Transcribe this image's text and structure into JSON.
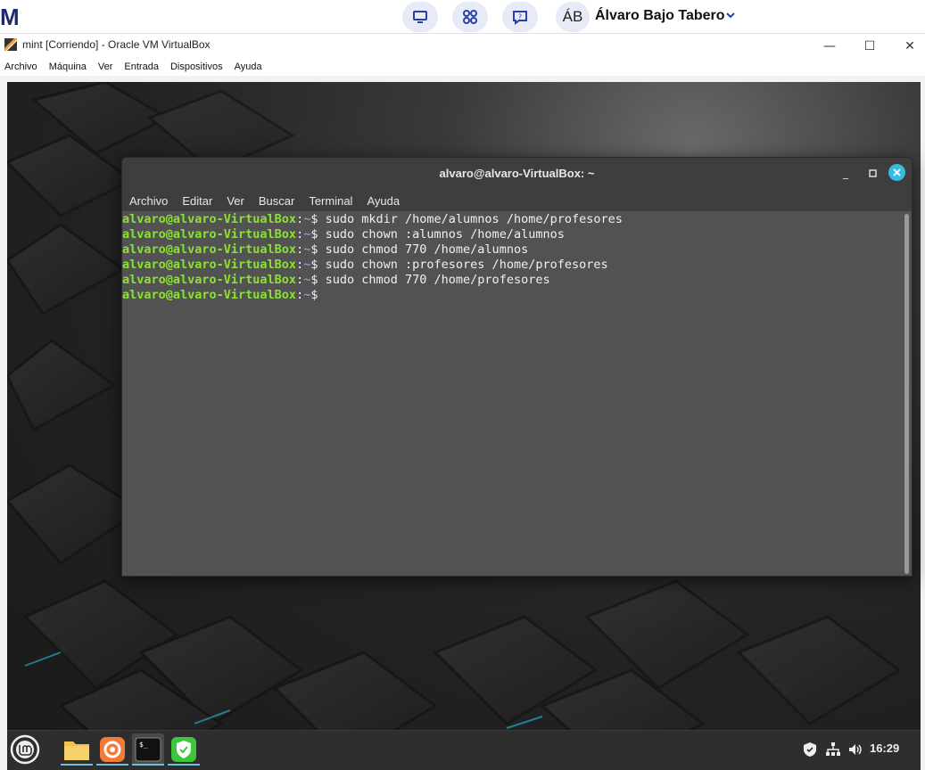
{
  "host": {
    "logo": "M",
    "avatar_initials": "ÁB",
    "user_name": "Álvaro Bajo Tabero",
    "icons": [
      "monitor-icon",
      "apps-icon",
      "help-chat-icon",
      "chevron-down-icon"
    ]
  },
  "vbox": {
    "title": "mint [Corriendo] - Oracle VM VirtualBox",
    "menu": [
      "Archivo",
      "Máquina",
      "Ver",
      "Entrada",
      "Dispositivos",
      "Ayuda"
    ],
    "controls": {
      "minimize": "—",
      "maximize": "☐",
      "close": "✕"
    }
  },
  "terminal": {
    "title": "alvaro@alvaro-VirtualBox: ~",
    "menu": [
      "Archivo",
      "Editar",
      "Ver",
      "Buscar",
      "Terminal",
      "Ayuda"
    ],
    "prompt_user": "alvaro@alvaro-VirtualBox",
    "prompt_path": "~",
    "lines": [
      "sudo mkdir /home/alumnos /home/profesores",
      "sudo chown :alumnos /home/alumnos",
      "sudo chmod 770 /home/alumnos",
      "sudo chown :profesores /home/profesores",
      "sudo chmod 770 /home/profesores",
      ""
    ]
  },
  "taskbar": {
    "apps": [
      "mint-menu-icon",
      "files-icon",
      "firefox-icon",
      "terminal-icon",
      "shield-vpn-icon"
    ],
    "tray": [
      "shield-update-icon",
      "network-icon",
      "volume-icon"
    ],
    "clock": "16:29"
  },
  "colors": {
    "prompt_user": "#8ae234",
    "prompt_path": "#729fcf",
    "terminal_bg": "#525252",
    "close_accent": "#35bde5"
  }
}
